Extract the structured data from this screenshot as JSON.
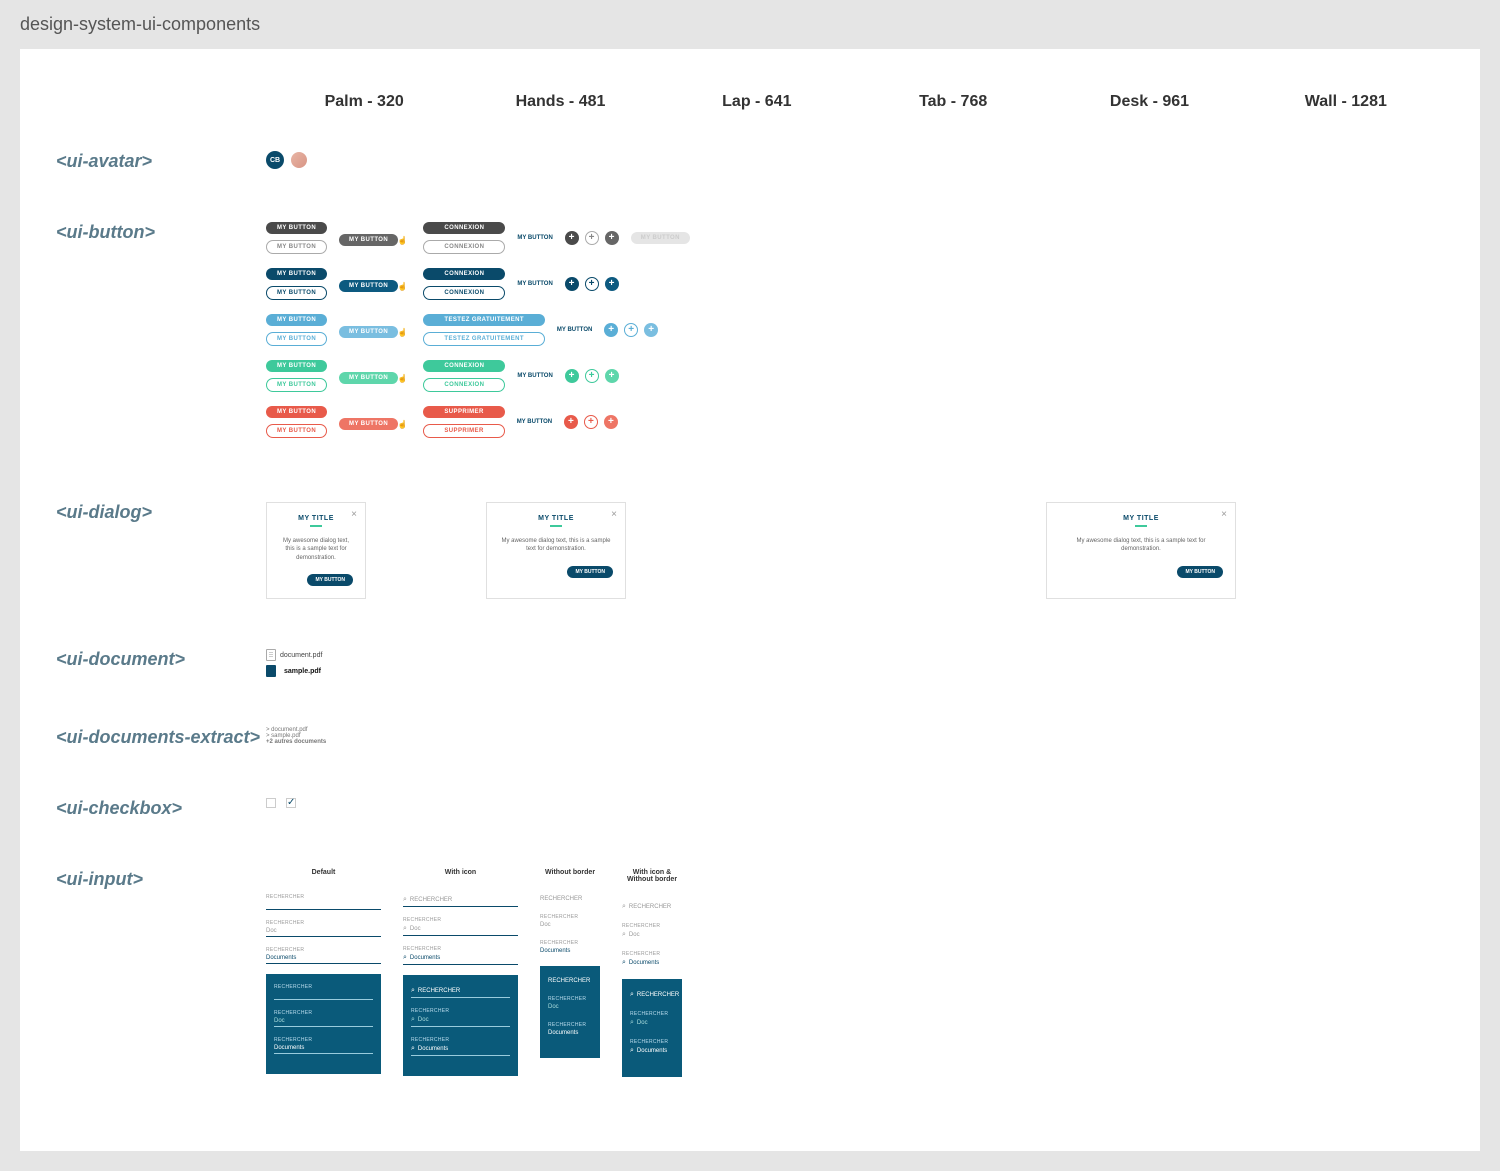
{
  "page_title": "design-system-ui-components",
  "breakpoints": [
    "Palm - 320",
    "Hands - 481",
    "Lap - 641",
    "Tab - 768",
    "Desk - 961",
    "Wall - 1281"
  ],
  "components": {
    "avatar": {
      "label": "<ui-avatar>",
      "initials": "CB"
    },
    "button": {
      "label": "<ui-button>",
      "my_button": "MY BUTTON",
      "variants": [
        {
          "wide": "CONNEXION"
        },
        {
          "wide": "CONNEXION"
        },
        {
          "wide": "TESTEZ GRATUITEMENT"
        },
        {
          "wide": "CONNEXION"
        },
        {
          "wide": "SUPPRIMER"
        }
      ]
    },
    "dialog": {
      "label": "<ui-dialog>",
      "title": "MY TITLE",
      "body_short": "My awesome dialog text, this is a sample text for demonstration.",
      "body_long": "My awesome dialog text, this is a sample text for demonstration.",
      "action": "MY BUTTON"
    },
    "document": {
      "label": "<ui-document>",
      "name1": "document.pdf",
      "name2": "sample.pdf"
    },
    "documents_extract": {
      "label": "<ui-documents-extract>",
      "items": [
        "> document.pdf",
        "> sample.pdf"
      ],
      "more": "+2 autres documents"
    },
    "checkbox": {
      "label": "<ui-checkbox>"
    },
    "input": {
      "label": "<ui-input>",
      "headers": [
        "Default",
        "With icon",
        "Without border",
        "With icon & Without border"
      ],
      "search_label": "RECHERCHER",
      "doc_placeholder": "Doc",
      "docs_value": "Documents"
    }
  }
}
